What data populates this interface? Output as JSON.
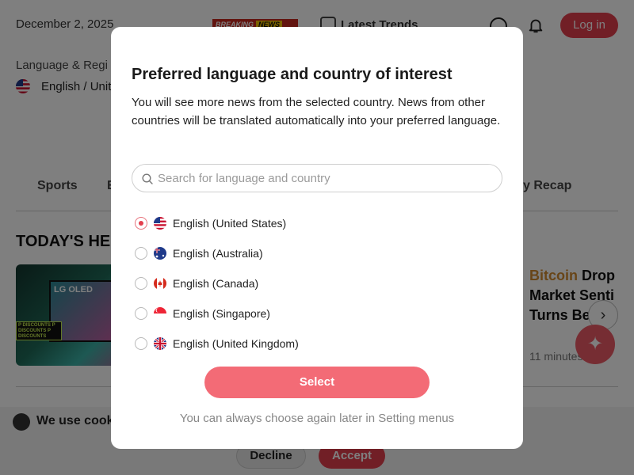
{
  "header": {
    "date": "December 2, 2025",
    "breaking_label": "BREAKING",
    "breaking_news": "NEWS",
    "latest_trends": "Latest Trends",
    "login_label": "Log in"
  },
  "region": {
    "label": "Language & Regi",
    "value": "English / Unite"
  },
  "nav": {
    "tab_sports": "Sports",
    "tab_partial": "E",
    "tab_recap": "y Recap"
  },
  "headlines": {
    "heading": "TODAY'S HE",
    "hero_logo": "LG OLED",
    "hero_promo": "P DISCOUNTS P DISCOUNTS P DISCOUNTS",
    "story_accent": "Bitcoin",
    "story_rest": "Drop",
    "story_line2": "Market Senti",
    "story_line3": "Turns Be",
    "story_time": "11 minutes ago"
  },
  "cookie": {
    "text": "We use cook",
    "decline": "Decline",
    "accept": "Accept"
  },
  "modal": {
    "title": "Preferred language and country of interest",
    "description": "You will see more news from the selected country. News from other countries will be translated automatically into your preferred language.",
    "search_placeholder": "Search for language and country",
    "options": [
      {
        "label": "English (United States)",
        "flag": "us-flag-icon",
        "selected": true
      },
      {
        "label": "English (Australia)",
        "flag": "au-flag-icon",
        "selected": false
      },
      {
        "label": "English (Canada)",
        "flag": "ca-flag-icon",
        "selected": false
      },
      {
        "label": "English (Singapore)",
        "flag": "sg-flag-icon",
        "selected": false
      },
      {
        "label": "English (United Kingdom)",
        "flag": "uk-flag-icon",
        "selected": false
      }
    ],
    "select_label": "Select",
    "footnote": "You can always choose again later in Setting menus"
  },
  "colors": {
    "accent": "#e33f4d",
    "select_button": "#f36b76",
    "story_accent": "#d08a30"
  }
}
